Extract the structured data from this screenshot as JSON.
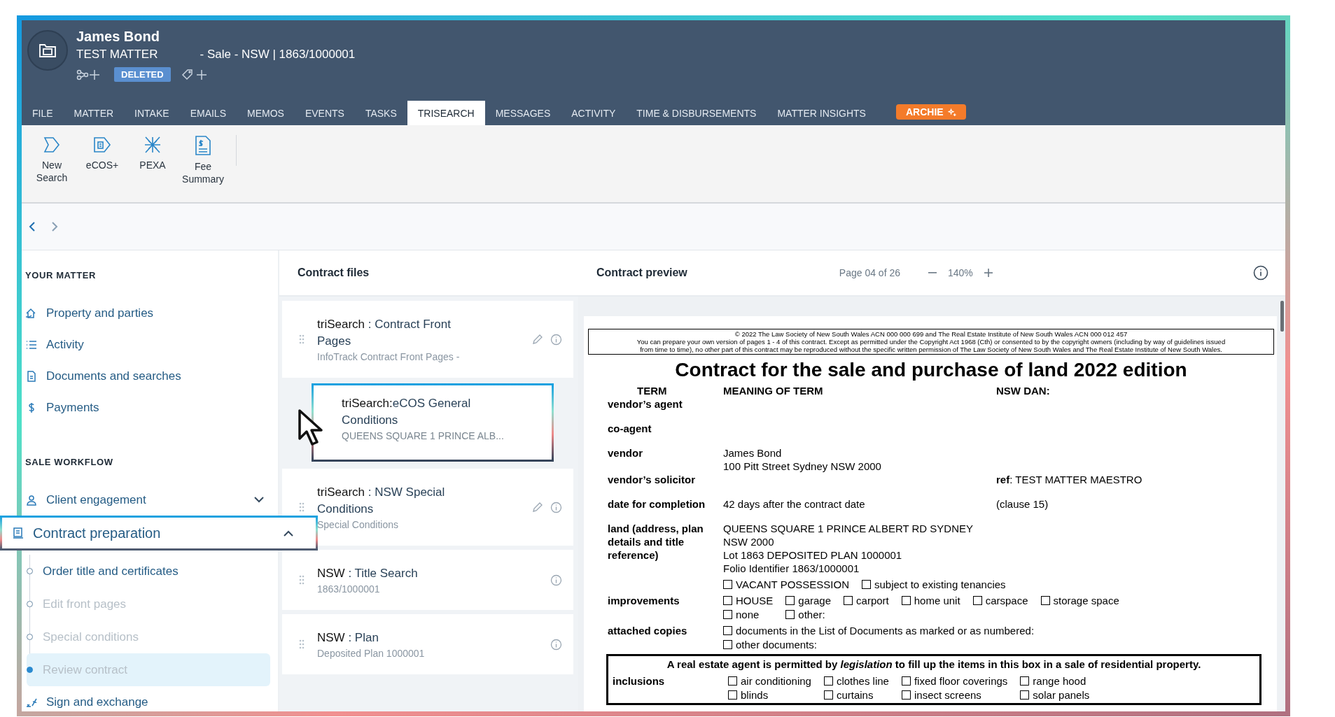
{
  "matter": {
    "client": "James Bond",
    "title": "TEST MATTER",
    "description": "- Sale - NSW | 1863/1000001",
    "status": "DELETED"
  },
  "tabs": [
    {
      "label": "FILE",
      "kind": "tab",
      "selected": false
    },
    {
      "label": "MATTER",
      "kind": "tab",
      "selected": false
    },
    {
      "label": "INTAKE",
      "kind": "tab",
      "selected": false
    },
    {
      "label": "EMAILS",
      "kind": "tab",
      "selected": false
    },
    {
      "label": "MEMOS",
      "kind": "tab",
      "selected": false
    },
    {
      "label": "EVENTS",
      "kind": "tab",
      "selected": false
    },
    {
      "label": "TASKS",
      "kind": "tab",
      "selected": false
    },
    {
      "label": "TRISEARCH",
      "kind": "tab",
      "selected": true
    },
    {
      "label": "MESSAGES",
      "kind": "tab",
      "selected": false
    },
    {
      "label": "ACTIVITY",
      "kind": "tab",
      "selected": false
    },
    {
      "label": "TIME & DISBURSEMENTS",
      "kind": "tab",
      "selected": false
    },
    {
      "label": "MATTER INSIGHTS",
      "kind": "tab",
      "selected": false
    },
    {
      "label": "ARCHIE",
      "kind": "assistant",
      "selected": false
    }
  ],
  "ribbon": [
    {
      "label": "New Search"
    },
    {
      "label": "eCOS+"
    },
    {
      "label": "PEXA"
    },
    {
      "label": "Fee Summary"
    }
  ],
  "sidebar": {
    "sections": [
      {
        "heading": "YOUR MATTER",
        "items": [
          {
            "label": "Property and parties"
          },
          {
            "label": "Activity"
          },
          {
            "label": "Documents and searches"
          },
          {
            "label": "Payments"
          }
        ]
      },
      {
        "heading": "SALE WORKFLOW",
        "items": [
          {
            "label": "Client engagement",
            "expanded": false,
            "highlighted": false
          },
          {
            "label": "Contract preparation",
            "expanded": true,
            "highlighted": true,
            "children": [
              {
                "label": "Order title and certificates",
                "disabled": false,
                "selected": false
              },
              {
                "label": "Edit front pages",
                "disabled": true,
                "selected": false
              },
              {
                "label": "Special conditions",
                "disabled": true,
                "selected": false
              },
              {
                "label": "Review contract",
                "disabled": true,
                "selected": true
              }
            ]
          },
          {
            "label": "Sign and exchange",
            "highlighted": false
          }
        ]
      }
    ]
  },
  "contract_files": {
    "title": "Contract files",
    "cards": [
      {
        "kind": "file",
        "prefix": "triSearch",
        "separator": ":",
        "title": "Contract Front Pages",
        "subtitle": "InfoTrack Contract Front Pages -",
        "editable": true
      },
      {
        "kind": "dragging",
        "prefix": "triSearch:",
        "title": "eCOS General Conditions",
        "subtitle": "QUEENS SQUARE 1 PRINCE ALB..."
      },
      {
        "kind": "file",
        "prefix": "triSearch",
        "separator": ":",
        "title": "NSW Special Conditions",
        "subtitle": "Special Conditions",
        "editable": true
      },
      {
        "kind": "file",
        "prefix": "NSW",
        "separator": ":",
        "title": "Title Search",
        "subtitle": "1863/1000001",
        "editable": false
      },
      {
        "kind": "file",
        "prefix": "NSW",
        "separator": ":",
        "title": "Plan",
        "subtitle": "Deposited Plan 1000001",
        "editable": false
      }
    ]
  },
  "preview": {
    "title": "Contract preview",
    "page": "Page 04 of 26",
    "zoom": "140%",
    "document": {
      "notice": [
        "© 2022 The Law Society of New South Wales ACN 000 000 699 and The Real Estate Institute of New South Wales ACN 000 012 457",
        "You can prepare your own version of pages 1 - 4 of this contract. Except as permitted under the Copyright Act 1968 (Cth) or consented to by the copyright owners (including by way of guidelines issued",
        "from time to time), no other part of this contract may be reproduced without the specific written permission of The Law Society of New South Wales and The Real Estate Institute of New South Wales."
      ],
      "heading": "Contract for the sale and purchase of land 2022 edition",
      "columns": [
        "TERM",
        "MEANING OF TERM",
        "NSW DAN:"
      ],
      "rows": [
        {
          "kind": "text",
          "term": "vendor’s agent"
        },
        {
          "kind": "text",
          "term": "co-agent"
        },
        {
          "kind": "text",
          "term": "vendor",
          "lines": [
            "James Bond",
            "100 Pitt Street Sydney NSW 2000"
          ]
        },
        {
          "kind": "text",
          "term": "vendor’s solicitor",
          "aside": "**ref**: TEST MATTER MAESTRO"
        },
        {
          "kind": "text",
          "term": "date for completion",
          "lines": [
            "42 days after the contract date"
          ],
          "aside": "(clause 15)"
        },
        {
          "kind": "text",
          "term": "land (address, plan details and title reference)",
          "lines": [
            "QUEENS SQUARE 1 PRINCE ALBERT RD SYDNEY NSW 2000",
            "Lot 1863 DEPOSITED PLAN 1000001",
            "Folio Identifier 1863/1000001"
          ]
        },
        {
          "kind": "options",
          "option_rows": [
            [
              {
                "label": "VACANT POSSESSION",
                "checked": false
              },
              {
                "label": "subject to existing tenancies",
                "checked": false
              }
            ]
          ]
        },
        {
          "kind": "options",
          "term": "improvements",
          "option_rows": [
            [
              {
                "label": "HOUSE",
                "checked": false
              },
              {
                "label": "garage",
                "checked": false
              },
              {
                "label": "carport",
                "checked": false
              },
              {
                "label": "home unit",
                "checked": false
              },
              {
                "label": "carspace",
                "checked": false
              },
              {
                "label": "storage space",
                "checked": false
              }
            ],
            [
              {
                "label": "none",
                "checked": false
              },
              {
                "label": "other:",
                "checked": false
              }
            ]
          ]
        },
        {
          "kind": "options",
          "term": "attached copies",
          "option_rows": [
            [
              {
                "label": "documents in the List of Documents as marked or as numbered:",
                "checked": false
              }
            ],
            [
              {
                "label": "other documents:",
                "checked": false
              }
            ]
          ]
        }
      ],
      "notice_box": {
        "heading": "A real estate agent is permitted by *legislation* to fill up the items in this box in a sale of residential property.",
        "term": "inclusions",
        "option_rows": [
          [
            {
              "label": "air conditioning",
              "checked": false
            },
            {
              "label": "clothes line",
              "checked": false
            },
            {
              "label": "fixed floor coverings",
              "checked": false
            },
            {
              "label": "range hood",
              "checked": false
            }
          ],
          [
            {
              "label": "blinds",
              "checked": false
            },
            {
              "label": "curtains",
              "checked": false
            },
            {
              "label": "insect screens",
              "checked": false
            },
            {
              "label": "solar panels",
              "checked": false
            }
          ]
        ]
      }
    }
  }
}
